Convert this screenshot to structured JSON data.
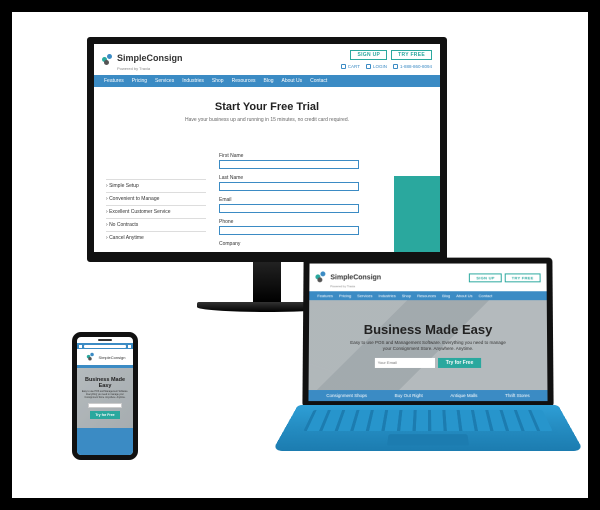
{
  "brand": {
    "name": "SimpleConsign",
    "tagline": "Powered by Traxia"
  },
  "header": {
    "signup_label": "SIGN UP",
    "tryfree_label": "TRY FREE",
    "cart_label": "CART",
    "login_label": "LOGIN",
    "phone": "1-888-860-8094"
  },
  "nav": {
    "items": [
      "Features",
      "Pricing",
      "Services",
      "Industries",
      "Shop",
      "Resources",
      "Blog",
      "About Us",
      "Contact"
    ]
  },
  "monitor_page": {
    "title": "Start Your Free Trial",
    "subtitle": "Have your business up and running in 15 minutes, no credit card required.",
    "fields": {
      "first_name": "First Name",
      "last_name": "Last Name",
      "email": "Email",
      "phone": "Phone",
      "company": "Company"
    },
    "benefits": [
      "Simple Setup",
      "Convenient to Manage",
      "Excellent Customer Service",
      "No Contracts",
      "Cancel Anytime"
    ]
  },
  "laptop_page": {
    "title": "Business Made Easy",
    "subtitle": "Easy to use POS and Management Software. Everything you need to manage your Consignment Store. Anywhere. Anytime.",
    "email_placeholder": "Your Email",
    "cta_label": "Try for Free",
    "strip": [
      "Consignment Shops",
      "Buy Out Right",
      "Antique Malls",
      "Thrift Stores"
    ]
  },
  "phone_page": {
    "title": "Business Made Easy",
    "subtitle": "Easy to use POS and Management Software. Everything you need to manage your Consignment Store. Anywhere. Anytime.",
    "cta_label": "Try for Free"
  }
}
